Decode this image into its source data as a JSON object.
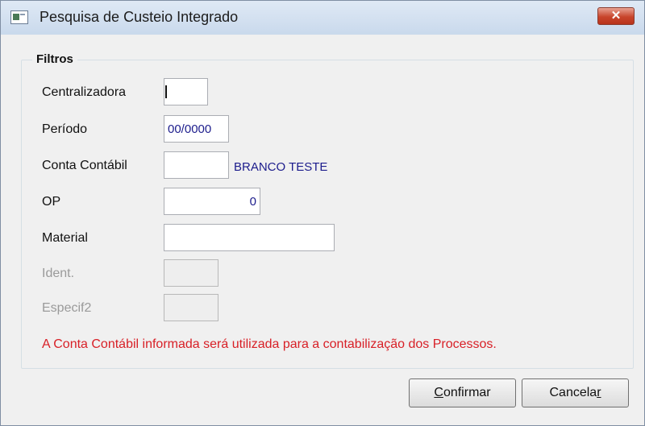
{
  "window": {
    "title": "Pesquisa de Custeio Integrado",
    "close_label": "✕"
  },
  "filters": {
    "legend": "Filtros",
    "centralizadora": {
      "label": "Centralizadora",
      "value": ""
    },
    "periodo": {
      "label": "Período",
      "value": "00/0000"
    },
    "conta_contabil": {
      "label": "Conta Contábil",
      "value": "",
      "description": "BRANCO TESTE"
    },
    "op": {
      "label": "OP",
      "value": "0"
    },
    "material": {
      "label": "Material",
      "value": ""
    },
    "ident": {
      "label": "Ident.",
      "value": "",
      "disabled": true
    },
    "especif2": {
      "label": "Especif2",
      "value": "",
      "disabled": true
    },
    "warning": "A Conta Contábil informada será utilizada para a contabilização dos Processos."
  },
  "buttons": {
    "confirm": {
      "underlined": "C",
      "rest": "onfirmar"
    },
    "cancel": {
      "rest": "Cancela",
      "underlined": "r"
    }
  },
  "colors": {
    "warning": "#d81f26",
    "value_text": "#1c1c8c",
    "close_button": "#c8452c"
  }
}
